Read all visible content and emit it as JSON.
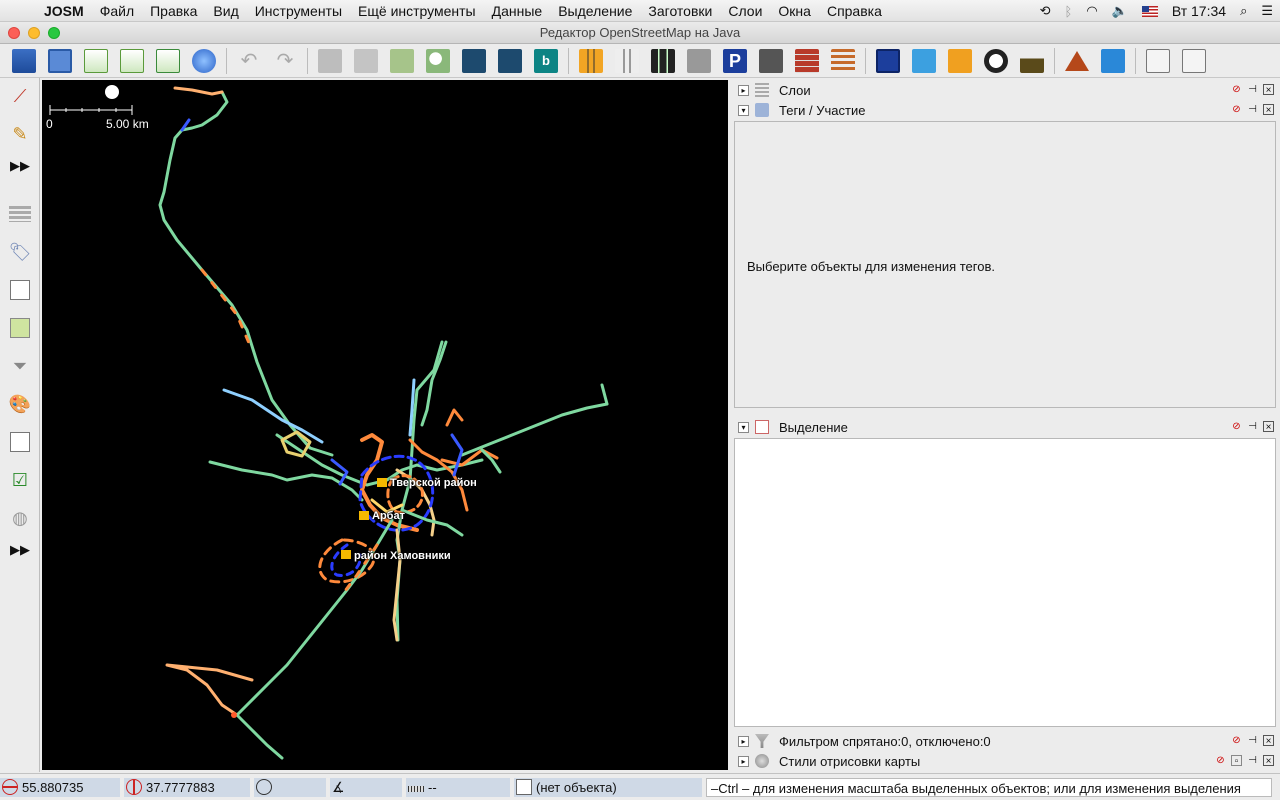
{
  "menubar": {
    "app_name": "JOSM",
    "items": [
      "Файл",
      "Правка",
      "Вид",
      "Инструменты",
      "Ещё инструменты",
      "Данные",
      "Выделение",
      "Заготовки",
      "Слои",
      "Окна",
      "Справка"
    ],
    "clock": "Вт 17:34"
  },
  "window": {
    "title": "Редактор OpenStreetMap на Java"
  },
  "map": {
    "scale_zero": "0",
    "scale_label": "5.00 km",
    "places": [
      "Тверской район",
      "Арбат",
      "район Хамовники"
    ]
  },
  "panels": {
    "layers": {
      "title": "Слои"
    },
    "tags": {
      "title": "Теги / Участие",
      "empty_message": "Выберите объекты для изменения тегов."
    },
    "selection": {
      "title": "Выделение"
    },
    "filter": {
      "title": "Фильтром спрятано:0, отключено:0"
    },
    "styles": {
      "title": "Стили отрисовки карты"
    }
  },
  "status": {
    "lat": "55.880735",
    "lon": "37.7777883",
    "heading": "",
    "angle": "",
    "distance": "--",
    "object": "(нет объекта)",
    "help": "–Ctrl – для изменения масштаба выделенных объектов; или для изменения выделения"
  },
  "colors": {
    "map_background": "#000000",
    "way_green": "#7fd8a0",
    "way_orange": "#ff8a3c",
    "way_blue": "#2a3cff",
    "status_field": "#cfd9e6"
  }
}
